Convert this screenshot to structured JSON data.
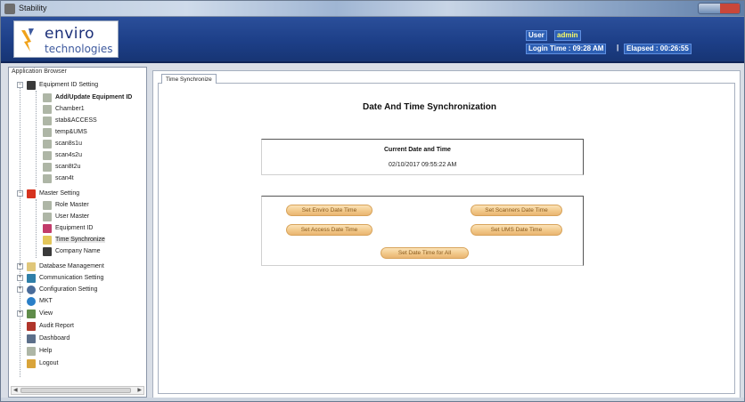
{
  "window": {
    "title": "Stability"
  },
  "logo": {
    "line1": "enviro",
    "line2": "technologies"
  },
  "header": {
    "user_label": "User",
    "user_value": "admin",
    "login_label": "Login Time : 09:28 AM",
    "separator": "|",
    "elapsed_label": "Elapsed : 00:26:55"
  },
  "tree": {
    "title": "Application Browser",
    "items": [
      {
        "label": "Equipment ID Setting",
        "icon": "computer-icon"
      },
      {
        "label": "Add/Update Equipment ID",
        "icon": "leaf-icon"
      },
      {
        "label": "Chamber1",
        "icon": "leaf-icon"
      },
      {
        "label": "stab&ACCESS",
        "icon": "leaf-icon"
      },
      {
        "label": "temp&UMS",
        "icon": "leaf-icon"
      },
      {
        "label": "scan8s1u",
        "icon": "leaf-icon"
      },
      {
        "label": "scan4s2u",
        "icon": "leaf-icon"
      },
      {
        "label": "scan8t2u",
        "icon": "leaf-icon"
      },
      {
        "label": "scan4t",
        "icon": "leaf-icon"
      },
      {
        "label": "Master Setting",
        "icon": "flag-icon"
      },
      {
        "label": "Role Master",
        "icon": "leaf-icon"
      },
      {
        "label": "User Master",
        "icon": "leaf-icon"
      },
      {
        "label": "Equipment ID",
        "icon": "user-icon"
      },
      {
        "label": "Time Synchronize",
        "icon": "clock-icon"
      },
      {
        "label": "Company Name",
        "icon": "computer-icon"
      },
      {
        "label": "Database Management",
        "icon": "database-icon"
      },
      {
        "label": "Communication Setting",
        "icon": "network-icon"
      },
      {
        "label": "Configuration Setting",
        "icon": "gear-icon"
      },
      {
        "label": "MKT",
        "icon": "globe-icon"
      },
      {
        "label": "View",
        "icon": "grid-icon"
      },
      {
        "label": "Audit Report",
        "icon": "report-icon"
      },
      {
        "label": "Dashboard",
        "icon": "dashboard-icon"
      },
      {
        "label": "Help",
        "icon": "help-icon"
      },
      {
        "label": "Logout",
        "icon": "logout-icon"
      }
    ]
  },
  "tab": {
    "label": "Time Synchronize"
  },
  "main": {
    "heading": "Date And Time Synchronization",
    "current_label": "Current Date and Time",
    "current_value": "02/10/2017 09:55:22 AM",
    "buttons": {
      "enviro": "Set Enviro Date  Time",
      "scanners": "Set Scanners Date  Time",
      "access": "Set Access Date  Time",
      "ums": "Set UMS Date  Time",
      "all": "Set Date  Time for All"
    }
  },
  "colors": {
    "header_bg": "#1d3f88",
    "button_fill": "#f2c98a",
    "button_text": "#8a5a1e",
    "value_text": "#ffff66"
  }
}
